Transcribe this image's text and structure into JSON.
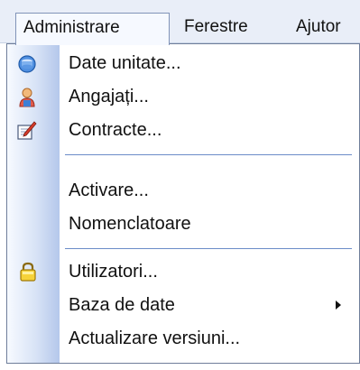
{
  "menubar": {
    "items": [
      {
        "label": "Administrare"
      },
      {
        "label": "Ferestre"
      },
      {
        "label": "Ajutor"
      }
    ]
  },
  "menu": {
    "items": [
      {
        "label": "Date unitate...",
        "icon": "database-icon"
      },
      {
        "label": "Angajați...",
        "icon": "user-icon"
      },
      {
        "label": "Contracte...",
        "icon": "document-edit-icon"
      },
      {
        "label": "Activare..."
      },
      {
        "label": "Nomenclatoare"
      },
      {
        "label": "Utilizatori...",
        "icon": "lock-icon"
      },
      {
        "label": "Baza de date",
        "submenu": true
      },
      {
        "label": "Actualizare versiuni..."
      }
    ]
  },
  "colors": {
    "menubar_bg": "#e9eef8",
    "gutter_edge": "#b4c7eb",
    "separator": "#6b8cc8",
    "menu_border": "#6f7e9a"
  }
}
